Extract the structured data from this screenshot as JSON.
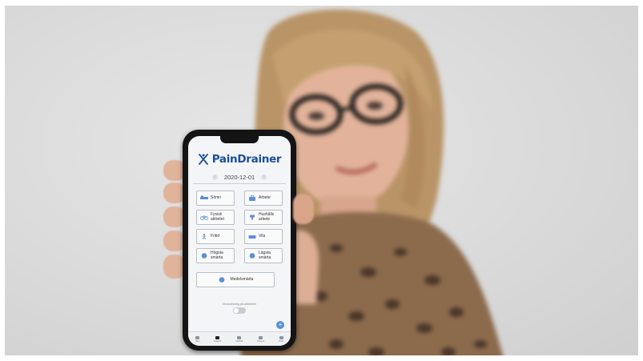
{
  "app": {
    "name": "PainDrainer",
    "date": "2020-12-01",
    "buttons": [
      {
        "label": "Sömn",
        "icon": "bed-icon"
      },
      {
        "label": "Arbete",
        "icon": "briefcase-icon"
      },
      {
        "label": "Fysisk aktivitet",
        "icon": "bicycle-icon"
      },
      {
        "label": "Hushålls arbete",
        "icon": "household-icon"
      },
      {
        "label": "Fritid",
        "icon": "leisure-icon"
      },
      {
        "label": "Vila",
        "icon": "sofa-icon"
      },
      {
        "label": "Högsta smärta",
        "icon": "sad-face-icon"
      },
      {
        "label": "Lägsta smärta",
        "icon": "happy-face-icon"
      }
    ],
    "average_button": {
      "label": "Medelsmärta",
      "icon": "neutral-face-icon"
    },
    "toggle_label": "Veckovisning på aktiviteter",
    "fab": "+",
    "tabs": [
      "Start",
      "Dagbok",
      "Statistik",
      "Planera",
      "Profil"
    ]
  },
  "colors": {
    "brand_blue": "#1b4e9b",
    "icon_blue": "#5b8fd9"
  }
}
